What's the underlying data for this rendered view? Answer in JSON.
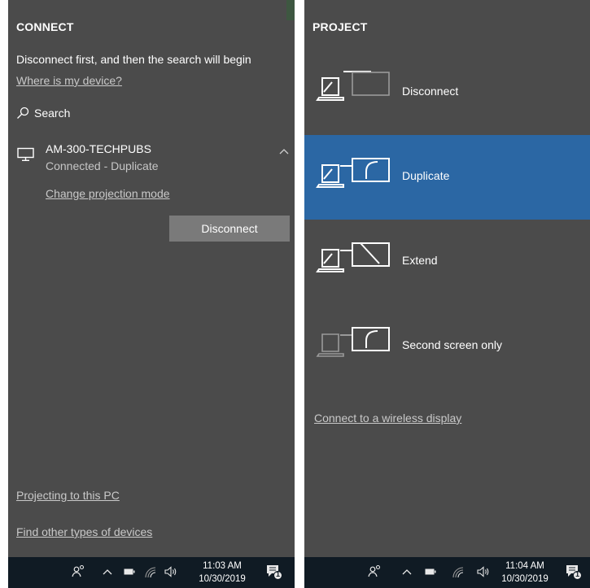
{
  "connect": {
    "title": "CONNECT",
    "message": "Disconnect first, and then the search will begin",
    "where_link": "Where is my device?",
    "search_label": "Search",
    "device": {
      "name": "AM-300-TECHPUBS",
      "status": "Connected - Duplicate",
      "change_mode_link": "Change projection mode",
      "disconnect_button": "Disconnect"
    },
    "projecting_link": "Projecting to this PC",
    "find_link": "Find other types of devices"
  },
  "project": {
    "title": "PROJECT",
    "options": [
      {
        "label": "Disconnect",
        "selected": false
      },
      {
        "label": "Duplicate",
        "selected": true
      },
      {
        "label": "Extend",
        "selected": false
      },
      {
        "label": "Second screen only",
        "selected": false
      }
    ],
    "wireless_link": "Connect to a wireless display"
  },
  "taskbar_left": {
    "time": "11:03 AM",
    "date": "10/30/2019",
    "notifications": "1"
  },
  "taskbar_right": {
    "time": "11:04 AM",
    "date": "10/30/2019",
    "notifications": "1"
  },
  "colors": {
    "panel": "#4b4b4b",
    "accent": "#2b67a4",
    "taskbar": "#101b24"
  }
}
